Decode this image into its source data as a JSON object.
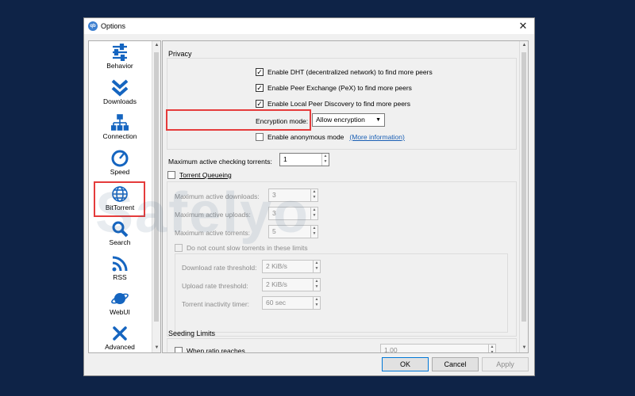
{
  "window": {
    "title": "Options",
    "app_icon_glyph": "qb",
    "close_glyph": "✕"
  },
  "sidebar": {
    "items": [
      {
        "label": "Behavior",
        "icon": "sliders-icon"
      },
      {
        "label": "Downloads",
        "icon": "double-chevron-down-icon"
      },
      {
        "label": "Connection",
        "icon": "network-icon"
      },
      {
        "label": "Speed",
        "icon": "speedometer-icon"
      },
      {
        "label": "BitTorrent",
        "icon": "globe-icon"
      },
      {
        "label": "Search",
        "icon": "magnifier-icon"
      },
      {
        "label": "RSS",
        "icon": "rss-icon"
      },
      {
        "label": "WebUI",
        "icon": "planet-icon"
      },
      {
        "label": "Advanced",
        "icon": "tools-icon"
      }
    ],
    "selected": "BitTorrent"
  },
  "privacy": {
    "title": "Privacy",
    "dht_label": "Enable DHT (decentralized network) to find more peers",
    "dht_checked": true,
    "pex_label": "Enable Peer Exchange (PeX) to find more peers",
    "pex_checked": true,
    "lpd_label": "Enable Local Peer Discovery to find more peers",
    "lpd_checked": true,
    "encryption_label": "Encryption mode:",
    "encryption_value": "Allow encryption",
    "anonymous_label": "Enable anonymous mode",
    "anonymous_checked": false,
    "more_info": "(More information)"
  },
  "checking": {
    "label": "Maximum active checking torrents:",
    "value": "1"
  },
  "queueing": {
    "label": "Torrent Queueing",
    "checked": false,
    "downloads_label": "Maximum active downloads:",
    "downloads_value": "3",
    "uploads_label": "Maximum active uploads:",
    "uploads_value": "3",
    "torrents_label": "Maximum active torrents:",
    "torrents_value": "5",
    "slow_label": "Do not count slow torrents in these limits",
    "dl_threshold_label": "Download rate threshold:",
    "dl_threshold_value": "2 KiB/s",
    "ul_threshold_label": "Upload rate threshold:",
    "ul_threshold_value": "2 KiB/s",
    "inactivity_label": "Torrent inactivity timer:",
    "inactivity_value": "60 sec"
  },
  "seeding": {
    "title": "Seeding Limits",
    "ratio_label": "When ratio reaches",
    "ratio_value": "1.00"
  },
  "buttons": {
    "ok": "OK",
    "cancel": "Cancel",
    "apply": "Apply"
  },
  "watermark": "Safelyo",
  "colors": {
    "background": "#0e2347",
    "highlight": "#e53b3b",
    "icon_blue": "#1565c0",
    "link": "#1a5fb4"
  }
}
